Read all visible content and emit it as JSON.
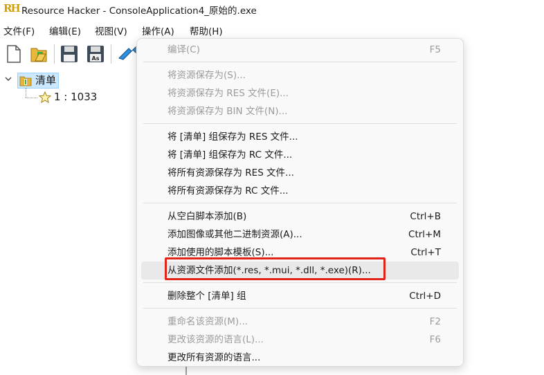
{
  "window": {
    "logo": "RH",
    "title": "Resource Hacker - ConsoleApplication4_原始的.exe"
  },
  "menubar": [
    {
      "label": "文件(F)"
    },
    {
      "label": "编辑(E)"
    },
    {
      "label": "视图(V)"
    },
    {
      "label": "操作(A)"
    },
    {
      "label": "帮助(H)"
    }
  ],
  "toolbar": {
    "buttons": [
      "new-file-icon",
      "open-folder-icon",
      "save-icon",
      "save-as-icon",
      "compile-arrow-icon"
    ]
  },
  "tree": {
    "root_label": "清单",
    "child_label": "1 : 1033"
  },
  "context_menu": {
    "items": [
      {
        "label": "编译(C)",
        "shortcut": "F5",
        "disabled": true
      },
      {
        "label": "将资源保存为(S)...",
        "shortcut": "",
        "disabled": true
      },
      {
        "label": "将资源保存为 RES 文件(E)...",
        "shortcut": "",
        "disabled": true
      },
      {
        "label": "将资源保存为 BIN 文件(N)...",
        "shortcut": "",
        "disabled": true
      },
      {
        "label": "将 [清单] 组保存为 RES 文件...",
        "shortcut": "",
        "disabled": false
      },
      {
        "label": "将 [清单] 组保存为 RC 文件...",
        "shortcut": "",
        "disabled": false
      },
      {
        "label": "将所有资源保存为 RES 文件...",
        "shortcut": "",
        "disabled": false
      },
      {
        "label": "将所有资源保存为 RC 文件...",
        "shortcut": "",
        "disabled": false
      },
      {
        "label": "从空白脚本添加(B)",
        "shortcut": "Ctrl+B",
        "disabled": false
      },
      {
        "label": "添加图像或其他二进制资源(A)...",
        "shortcut": "Ctrl+M",
        "disabled": false
      },
      {
        "label": "添加使用的脚本模板(S)...",
        "shortcut": "Ctrl+T",
        "disabled": false
      },
      {
        "label": "从资源文件添加(*.res, *.mui, *.dll, *.exe)(R)...",
        "shortcut": "",
        "disabled": false,
        "hovered": true
      },
      {
        "label": "删除整个 [清单] 组",
        "shortcut": "Ctrl+D",
        "disabled": false
      },
      {
        "label": "重命名该资源(M)...",
        "shortcut": "F2",
        "disabled": true
      },
      {
        "label": "更改该资源的语言(L)...",
        "shortcut": "F6",
        "disabled": true
      },
      {
        "label": "更改所有资源的语言...",
        "shortcut": "",
        "disabled": false
      }
    ]
  },
  "colors": {
    "highlight_outline": "#e2231a",
    "tree_selection": "#cce8ff",
    "disabled_text": "#9b9b9b"
  }
}
